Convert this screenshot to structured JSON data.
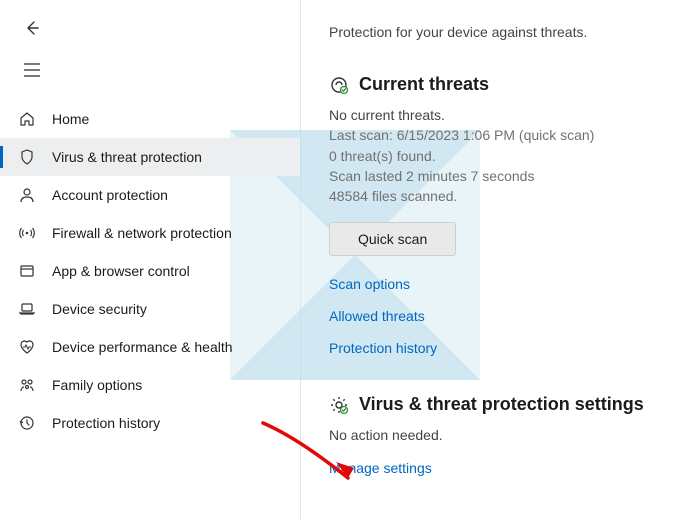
{
  "header": {
    "subtitle": "Protection for your device against threats."
  },
  "sidebar": {
    "items": [
      {
        "label": "Home"
      },
      {
        "label": "Virus & threat protection"
      },
      {
        "label": "Account protection"
      },
      {
        "label": "Firewall & network protection"
      },
      {
        "label": "App & browser control"
      },
      {
        "label": "Device security"
      },
      {
        "label": "Device performance & health"
      },
      {
        "label": "Family options"
      },
      {
        "label": "Protection history"
      }
    ]
  },
  "current_threats": {
    "title": "Current threats",
    "no_threats": "No current threats.",
    "last_scan": "Last scan: 6/15/2023 1:06 PM (quick scan)",
    "found": "0 threat(s) found.",
    "duration": "Scan lasted 2 minutes 7 seconds",
    "files": "48584 files scanned.",
    "quick_scan_btn": "Quick scan",
    "links": {
      "scan_options": "Scan options",
      "allowed": "Allowed threats",
      "history": "Protection history"
    }
  },
  "settings_section": {
    "title": "Virus & threat protection settings",
    "status": "No action needed.",
    "manage_link": "Manage settings"
  }
}
